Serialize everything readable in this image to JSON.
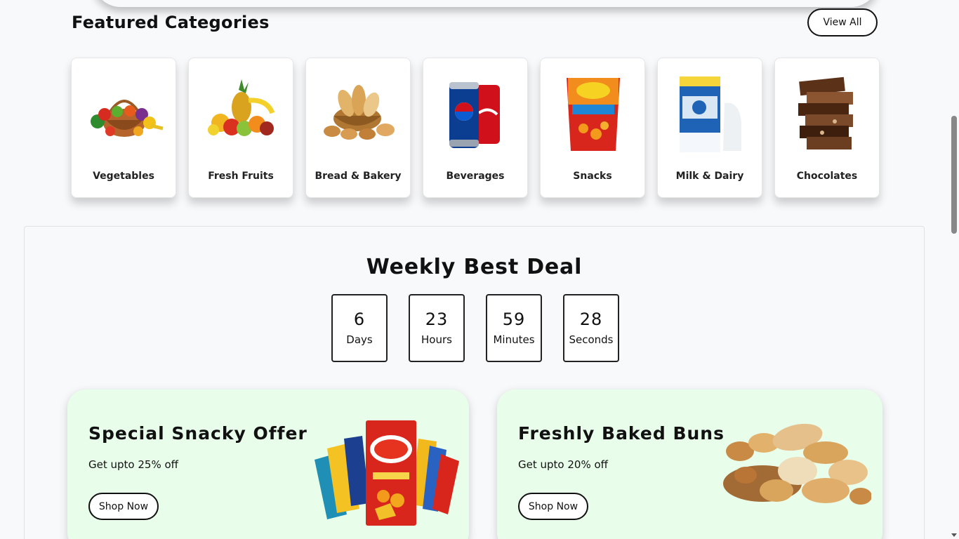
{
  "categories": {
    "title": "Featured Categories",
    "view_all_label": "View All",
    "items": [
      {
        "label": "Vegetables",
        "icon": "vegetables-basket-image"
      },
      {
        "label": "Fresh Fruits",
        "icon": "fresh-fruits-image"
      },
      {
        "label": "Bread & Bakery",
        "icon": "bread-basket-image"
      },
      {
        "label": "Beverages",
        "icon": "soda-cans-image"
      },
      {
        "label": "Snacks",
        "icon": "snack-bag-image"
      },
      {
        "label": "Milk & Dairy",
        "icon": "milk-carton-image"
      },
      {
        "label": "Chocolates",
        "icon": "chocolate-bars-image"
      }
    ]
  },
  "deal": {
    "title": "Weekly Best Deal",
    "timer": [
      {
        "value": "6",
        "unit": "Days"
      },
      {
        "value": "23",
        "unit": "Hours"
      },
      {
        "value": "59",
        "unit": "Minutes"
      },
      {
        "value": "28",
        "unit": "Seconds"
      }
    ]
  },
  "offers": [
    {
      "title": "Special Snacky Offer",
      "subtitle": "Get upto 25% off",
      "button": "Shop Now",
      "icon": "snack-bags-image"
    },
    {
      "title": "Freshly Baked Buns",
      "subtitle": "Get upto 20% off",
      "button": "Shop Now",
      "icon": "baked-buns-image"
    }
  ],
  "colors": {
    "page_bg": "#f8f9fb",
    "offer_bg": "#e8fdea",
    "text": "#111111"
  }
}
